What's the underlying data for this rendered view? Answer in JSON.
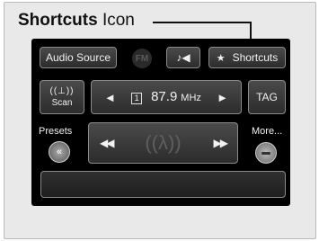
{
  "callout": {
    "bold": "Shortcuts",
    "rest": " Icon"
  },
  "screen": {
    "audio_source": "Audio Source",
    "fm_badge": "FM",
    "music_symbol": "♪◀",
    "shortcuts": {
      "star": "★",
      "label": "Shortcuts"
    },
    "scan": {
      "icon": "((⊥))",
      "label": "Scan"
    },
    "tuner": {
      "prev": "◄",
      "preset": "1",
      "frequency": "87.9",
      "unit": "MHz",
      "next": "►"
    },
    "tag": "TAG",
    "presets": {
      "label": "Presets",
      "knob": "«"
    },
    "track": {
      "prev": "◀◀",
      "icon": "((λ))",
      "next": "▶▶"
    },
    "more": {
      "label": "More..."
    }
  },
  "icons": [
    "star-icon",
    "radio-antenna-icon",
    "music-note-icon",
    "skip-back-icon",
    "skip-forward-icon",
    "chevron-left-double-icon",
    "minus-icon"
  ],
  "colors": {
    "screen_bg": "#000000",
    "button_bg": "#3a3a3a",
    "button_border": "#8a8a8a",
    "text": "#f2f2f2"
  }
}
